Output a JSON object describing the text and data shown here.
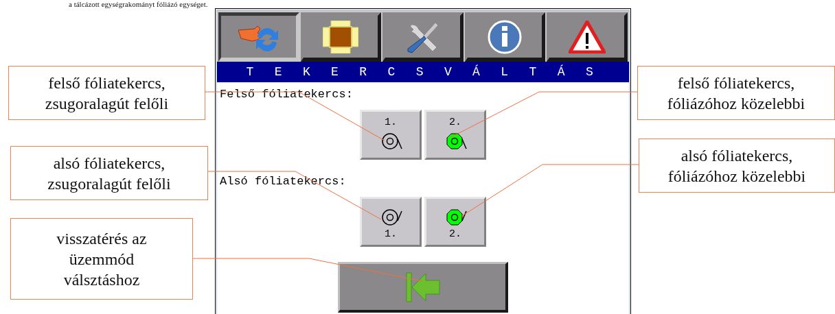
{
  "document_text": "a tálcázott egységrakományt fóliázó egységet.",
  "hmi": {
    "tabs": [
      {
        "selected": true
      },
      {
        "selected": false
      },
      {
        "selected": false
      },
      {
        "selected": false
      },
      {
        "selected": false
      }
    ],
    "title": "T E K E R C S V Á L T Á S",
    "sections": [
      {
        "label": "Felső fóliatekercs:",
        "kind": "upper",
        "rolls": [
          {
            "number": "1.",
            "active": false
          },
          {
            "number": "2.",
            "active": true
          }
        ]
      },
      {
        "label": "Alsó fóliatekercs:",
        "kind": "lower",
        "rolls": [
          {
            "number": "1.",
            "active": false
          },
          {
            "number": "2.",
            "active": true
          }
        ]
      }
    ]
  },
  "callouts": [
    {
      "text": "felső fóliatekercs,\nzsugoralagút felőli"
    },
    {
      "text": "alsó fóliatekercs,\nzsugoralagút felőli"
    },
    {
      "text": "visszatérés az\nüzemmód\nválsztáshoz"
    },
    {
      "text": "felső fóliatekercs,\nfóliázóhoz közelebbi"
    },
    {
      "text": "alsó fóliatekercs,\nfóliázóhoz közelebbi"
    }
  ]
}
